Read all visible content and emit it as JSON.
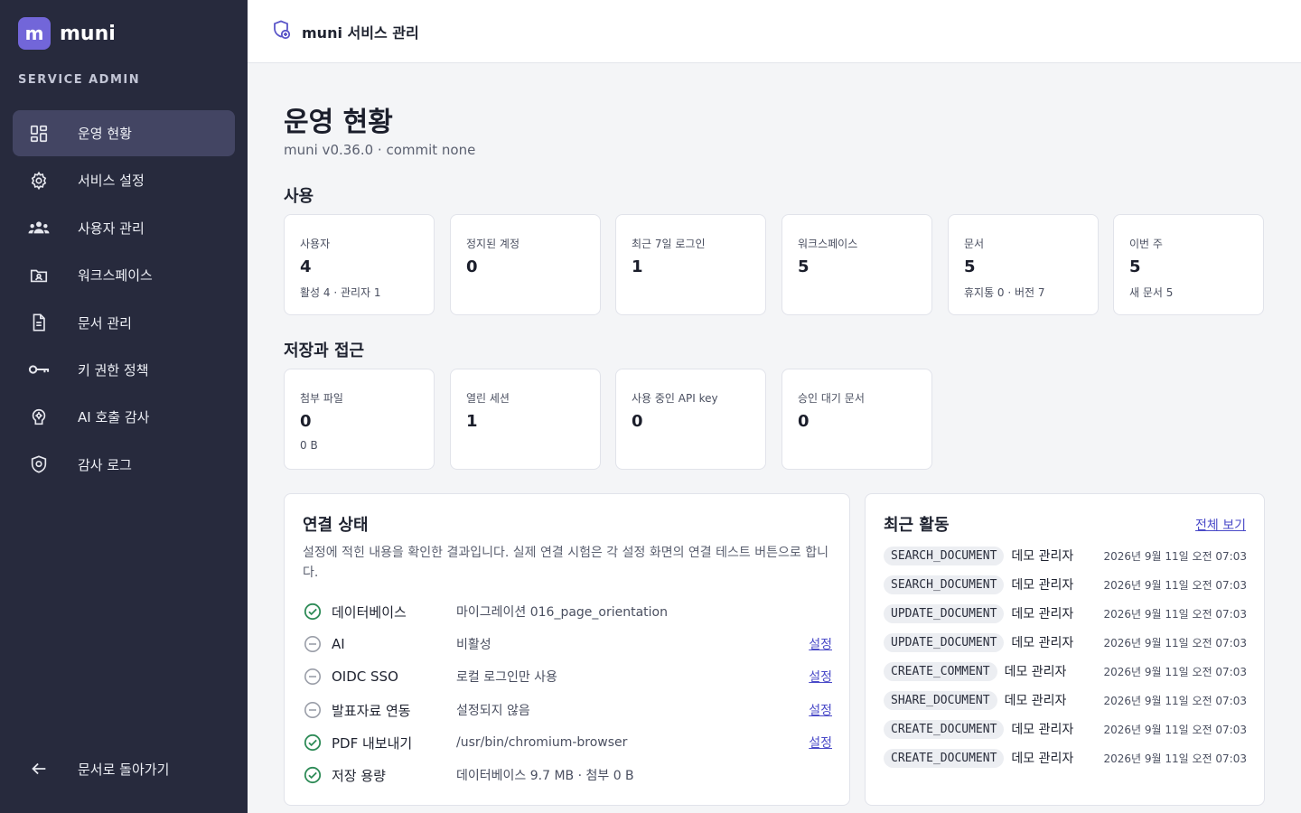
{
  "brand": {
    "logo_letter": "m",
    "name": "muni",
    "subtitle": "SERVICE ADMIN"
  },
  "sidebar": {
    "items": [
      {
        "label": "운영 현황",
        "icon": "dashboard-icon",
        "active": true
      },
      {
        "label": "서비스 설정",
        "icon": "gear-icon"
      },
      {
        "label": "사용자 관리",
        "icon": "users-icon"
      },
      {
        "label": "워크스페이스",
        "icon": "folder-user-icon"
      },
      {
        "label": "문서 관리",
        "icon": "document-icon"
      },
      {
        "label": "키 권한 정책",
        "icon": "key-icon"
      },
      {
        "label": "AI 호출 감사",
        "icon": "ai-brain-icon"
      },
      {
        "label": "감사 로그",
        "icon": "shield-icon"
      }
    ],
    "back_label": "문서로 돌아가기"
  },
  "header": {
    "title": "muni 서비스 관리"
  },
  "page": {
    "title": "운영 현황",
    "subtitle": "muni v0.36.0 · commit none"
  },
  "usage": {
    "title": "사용",
    "cards": [
      {
        "label": "사용자",
        "value": "4",
        "note": "활성 4 · 관리자 1"
      },
      {
        "label": "정지된 계정",
        "value": "0",
        "note": ""
      },
      {
        "label": "최근 7일 로그인",
        "value": "1",
        "note": ""
      },
      {
        "label": "워크스페이스",
        "value": "5",
        "note": ""
      },
      {
        "label": "문서",
        "value": "5",
        "note": "휴지통 0 · 버전 7"
      },
      {
        "label": "이번 주",
        "value": "5",
        "note": "새 문서 5"
      }
    ]
  },
  "storage": {
    "title": "저장과 접근",
    "cards": [
      {
        "label": "첨부 파일",
        "value": "0",
        "note": "0 B"
      },
      {
        "label": "열린 세션",
        "value": "1",
        "note": ""
      },
      {
        "label": "사용 중인 API key",
        "value": "0",
        "note": ""
      },
      {
        "label": "승인 대기 문서",
        "value": "0",
        "note": ""
      }
    ]
  },
  "connection": {
    "title": "연결 상태",
    "description": "설정에 적힌 내용을 확인한 결과입니다. 실제 연결 시험은 각 설정 화면의 연결 테스트 버튼으로 합니다.",
    "rows": [
      {
        "name": "데이터베이스",
        "detail": "마이그레이션 016_page_orientation",
        "status": "ok",
        "link": ""
      },
      {
        "name": "AI",
        "detail": "비활성",
        "status": "off",
        "link": "설정"
      },
      {
        "name": "OIDC SSO",
        "detail": "로컬 로그인만 사용",
        "status": "off",
        "link": "설정"
      },
      {
        "name": "발표자료 연동",
        "detail": "설정되지 않음",
        "status": "off",
        "link": "설정"
      },
      {
        "name": "PDF 내보내기",
        "detail": "/usr/bin/chromium-browser",
        "status": "ok",
        "link": "설정"
      },
      {
        "name": "저장 용량",
        "detail": "데이터베이스 9.7 MB · 첨부 0 B",
        "status": "ok",
        "link": ""
      }
    ]
  },
  "activity": {
    "title": "최근 활동",
    "see_all": "전체 보기",
    "rows": [
      {
        "action": "SEARCH_DOCUMENT",
        "user": "데모 관리자",
        "time": "2026년 9월 11일 오전 07:03"
      },
      {
        "action": "SEARCH_DOCUMENT",
        "user": "데모 관리자",
        "time": "2026년 9월 11일 오전 07:03"
      },
      {
        "action": "UPDATE_DOCUMENT",
        "user": "데모 관리자",
        "time": "2026년 9월 11일 오전 07:03"
      },
      {
        "action": "UPDATE_DOCUMENT",
        "user": "데모 관리자",
        "time": "2026년 9월 11일 오전 07:03"
      },
      {
        "action": "CREATE_COMMENT",
        "user": "데모 관리자",
        "time": "2026년 9월 11일 오전 07:03"
      },
      {
        "action": "SHARE_DOCUMENT",
        "user": "데모 관리자",
        "time": "2026년 9월 11일 오전 07:03"
      },
      {
        "action": "CREATE_DOCUMENT",
        "user": "데모 관리자",
        "time": "2026년 9월 11일 오전 07:03"
      },
      {
        "action": "CREATE_DOCUMENT",
        "user": "데모 관리자",
        "time": "2026년 9월 11일 오전 07:03"
      }
    ]
  },
  "colors": {
    "sidebar_bg": "#272a3d",
    "active_bg": "#434563",
    "accent": "#7266d9",
    "ok_green": "#2e8b57",
    "link": "#4a4ac8"
  }
}
